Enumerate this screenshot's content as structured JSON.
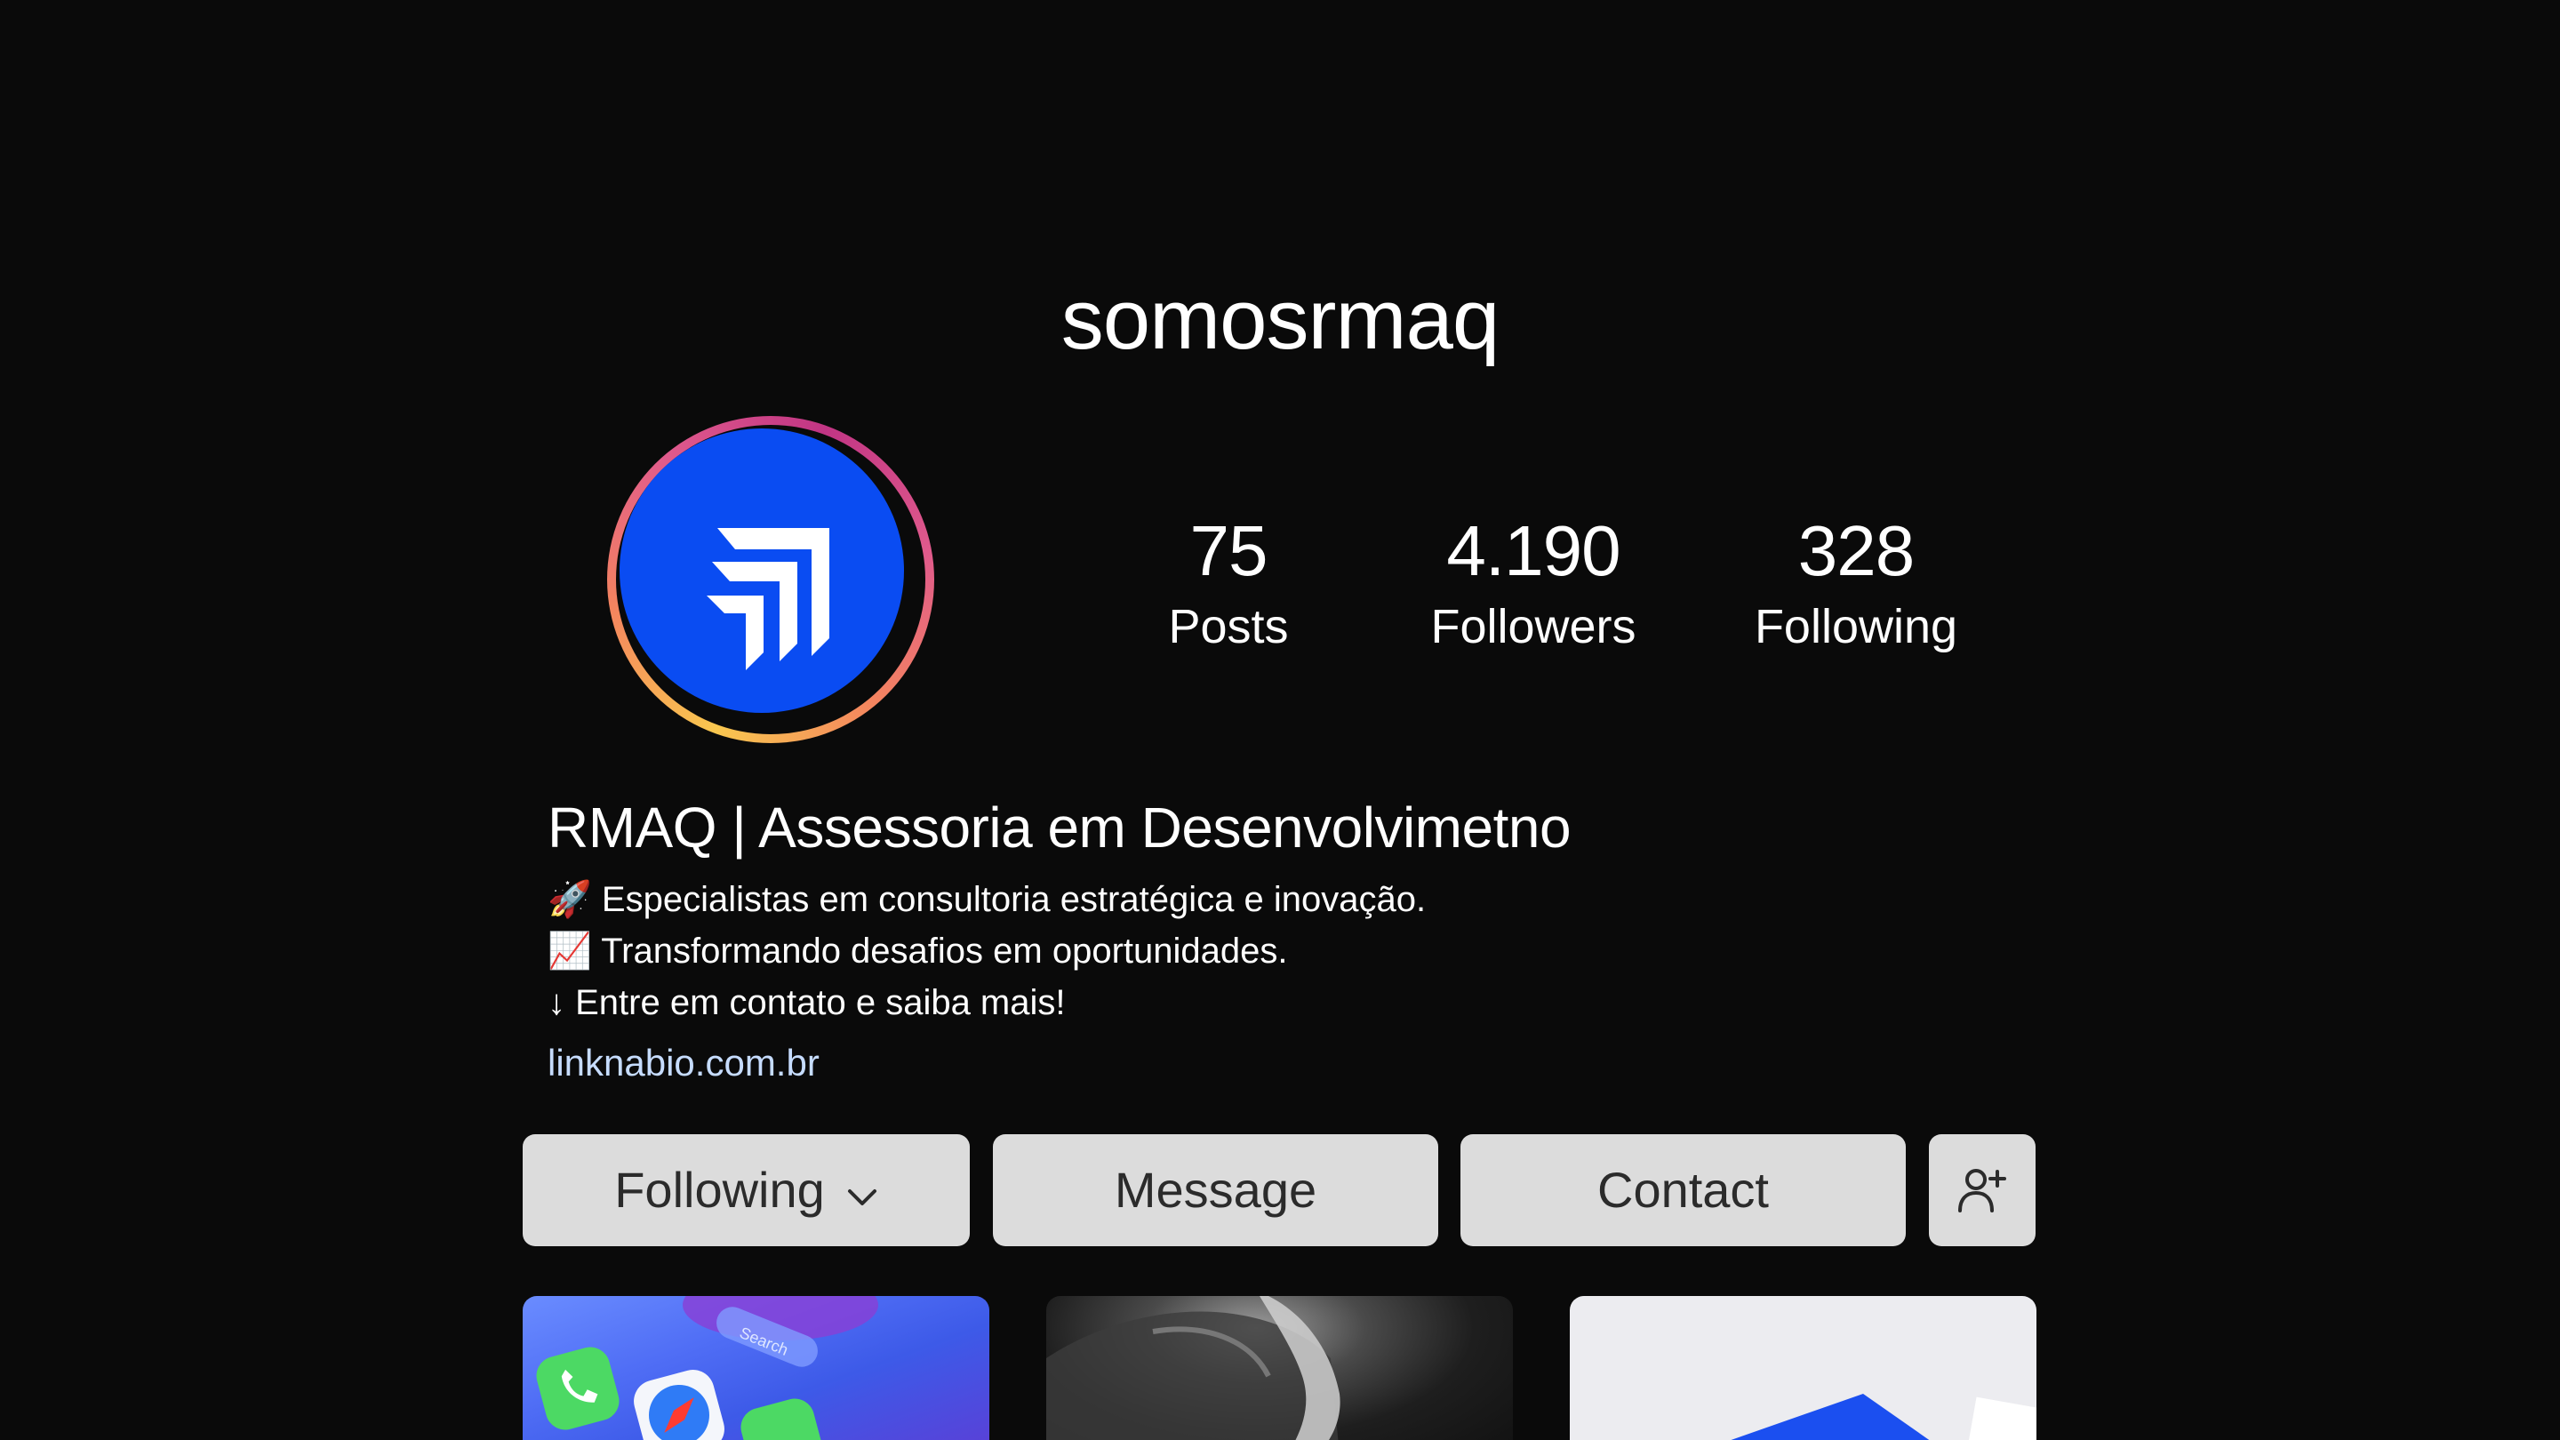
{
  "profile": {
    "username": "somosrmaq",
    "avatar_icon": "rmaq-logo-icon",
    "stats": {
      "posts": {
        "value": "75",
        "label": "Posts"
      },
      "followers": {
        "value": "4.190",
        "label": "Followers"
      },
      "following": {
        "value": "328",
        "label": "Following"
      }
    },
    "bio": {
      "name": "RMAQ | Assessoria em Desenvolvimetno",
      "line1": "🚀 Especialistas em consultoria estratégica e inovação.",
      "line2": "📈 Transformando desafios em oportunidades.",
      "line3": "↓ Entre em contato e saiba mais!",
      "link": "linknabio.com.br"
    }
  },
  "actions": {
    "following_label": "Following",
    "following_icon": "chevron-down-icon",
    "message_label": "Message",
    "contact_label": "Contact",
    "add_user_icon": "add-user-icon"
  },
  "posts_grid": [
    {
      "name": "post-thumbnail-phone-apps"
    },
    {
      "name": "post-thumbnail-hand"
    },
    {
      "name": "post-thumbnail-card"
    }
  ],
  "colors": {
    "background": "#0a0a0a",
    "avatar_blue": "#0a4cf2",
    "link": "#c6dcff",
    "button_bg": "#dcdcdc",
    "button_text": "#2b2b2b"
  }
}
